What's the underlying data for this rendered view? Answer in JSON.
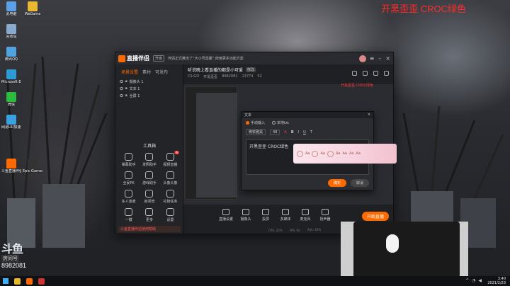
{
  "overlay_title": "开黑歪歪 CROC绿色",
  "overlay_title_small": "开黑歪歪 CROC绿色",
  "desktop_icons": [
    {
      "label": "此电脑",
      "color": "#5aa0e8"
    },
    {
      "label": "回收站",
      "color": "#88aacc"
    },
    {
      "label": "Microsoft Edge",
      "color": "#2d9ad8"
    },
    {
      "label": "斗鱼直播伴侣",
      "color": "#ff6a00"
    },
    {
      "label": "Epic Games Launcher",
      "color": "#333333"
    },
    {
      "label": "WeGame",
      "color": "#e8b830"
    },
    {
      "label": "网易UU加速器",
      "color": "#3aa0e0"
    },
    {
      "label": "腾讯QQ",
      "color": "#4fa3e0"
    },
    {
      "label": "微信",
      "color": "#2dbb3b"
    }
  ],
  "douyu_badge": {
    "mark": "斗鱼",
    "sub": "房间号",
    "room": "8982081"
  },
  "app": {
    "brand": "直播伴侣",
    "version": "升级",
    "notice": "伴侣正式推出了“大小号直播”,使用更多功能方案",
    "tabs": [
      {
        "label": "场景设置",
        "active": true
      },
      {
        "label": "素材",
        "active": false
      },
      {
        "label": "可发布",
        "active": false
      }
    ],
    "scenes": [
      "摄像头 1",
      "文本 1",
      "全屏 1"
    ],
    "tools_title": "工具箱",
    "tools": [
      {
        "label": "弹幕助手",
        "new": false
      },
      {
        "label": "发照助手",
        "new": false
      },
      {
        "label": "视频直播",
        "new": true
      },
      {
        "label": "全民PK",
        "new": false
      },
      {
        "label": "游戏助手",
        "new": false
      },
      {
        "label": "头像头像",
        "new": false
      },
      {
        "label": "多人连麦",
        "new": false
      },
      {
        "label": "房间管",
        "new": false
      },
      {
        "label": "礼物任务",
        "new": false
      },
      {
        "label": "一键",
        "new": false
      },
      {
        "label": "更多",
        "new": false
      },
      {
        "label": "设置",
        "new": false
      }
    ],
    "tip": "斗鱼直播伴侣使用帮助",
    "stream_title": "听说晚上看直播的都是小可爱",
    "edit_label": "修改",
    "stream_meta": [
      "CS:GO",
      "开黑歪歪",
      "8982081",
      "13774",
      "52"
    ],
    "bottom_buttons": [
      "直播设置",
      "摄像头",
      "投屏",
      "多媒体",
      "麦克风",
      "扬声器"
    ],
    "start_button": "开始直播",
    "status": [
      "CPU: 22%",
      "FPS: 60",
      "内存: 40%"
    ]
  },
  "dialog": {
    "title": "文本",
    "mode_manual": "手动输入",
    "mode_local": "本地txt",
    "toolbar": [
      "微软雅黑",
      "48",
      "A",
      "B",
      "I",
      "U",
      "T"
    ],
    "text_value": "开黑歪歪 CROC绿色",
    "ok": "确定",
    "cancel": "取消"
  },
  "sakura_chars": [
    "Aa",
    "Aa",
    "Aa",
    "Aa",
    "Aa",
    "Aa"
  ],
  "taskbar": {
    "time": "3:40",
    "date": "2021/2/23"
  }
}
